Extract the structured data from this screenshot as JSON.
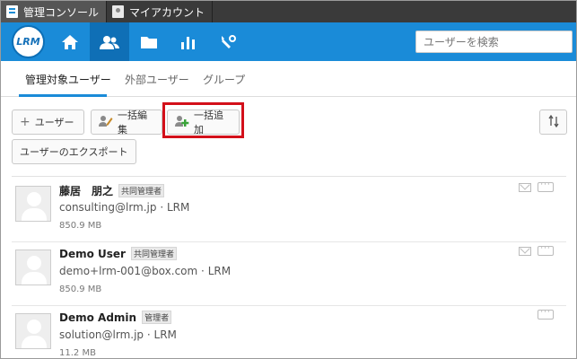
{
  "top_tabs": [
    {
      "label": "管理コンソール",
      "icon": "doc-icon"
    },
    {
      "label": "マイアカウント",
      "icon": "person-icon"
    }
  ],
  "nav": {
    "logo_text": "LRM",
    "icons": [
      "home-icon",
      "users-icon",
      "folder-icon",
      "reports-icon",
      "settings-icon"
    ],
    "search_placeholder": "ユーザーを検索"
  },
  "sub_tabs": [
    "管理対象ユーザー",
    "外部ユーザー",
    "グループ"
  ],
  "toolbar": {
    "add_user": "ユーザー",
    "bulk_edit": "一括編集",
    "bulk_add": "一括追加",
    "export": "ユーザーのエクスポート",
    "sort_icon": "sort-icon"
  },
  "users": [
    {
      "name": "藤居　朋之",
      "role": "共同管理者",
      "email": "consulting@lrm.jp",
      "org": "LRM",
      "size": "850.9 MB",
      "has_mail": true
    },
    {
      "name": "Demo User",
      "role": "共同管理者",
      "email": "demo+lrm-001@box.com",
      "org": "LRM",
      "size": "850.9 MB",
      "has_mail": true
    },
    {
      "name": "Demo Admin",
      "role": "管理者",
      "email": "solution@lrm.jp",
      "org": "LRM",
      "size": "11.2 MB",
      "has_mail": false
    }
  ],
  "email_separator": "·",
  "colors": {
    "brand_blue": "#1a8bd8",
    "highlight_red": "#d3101a"
  }
}
